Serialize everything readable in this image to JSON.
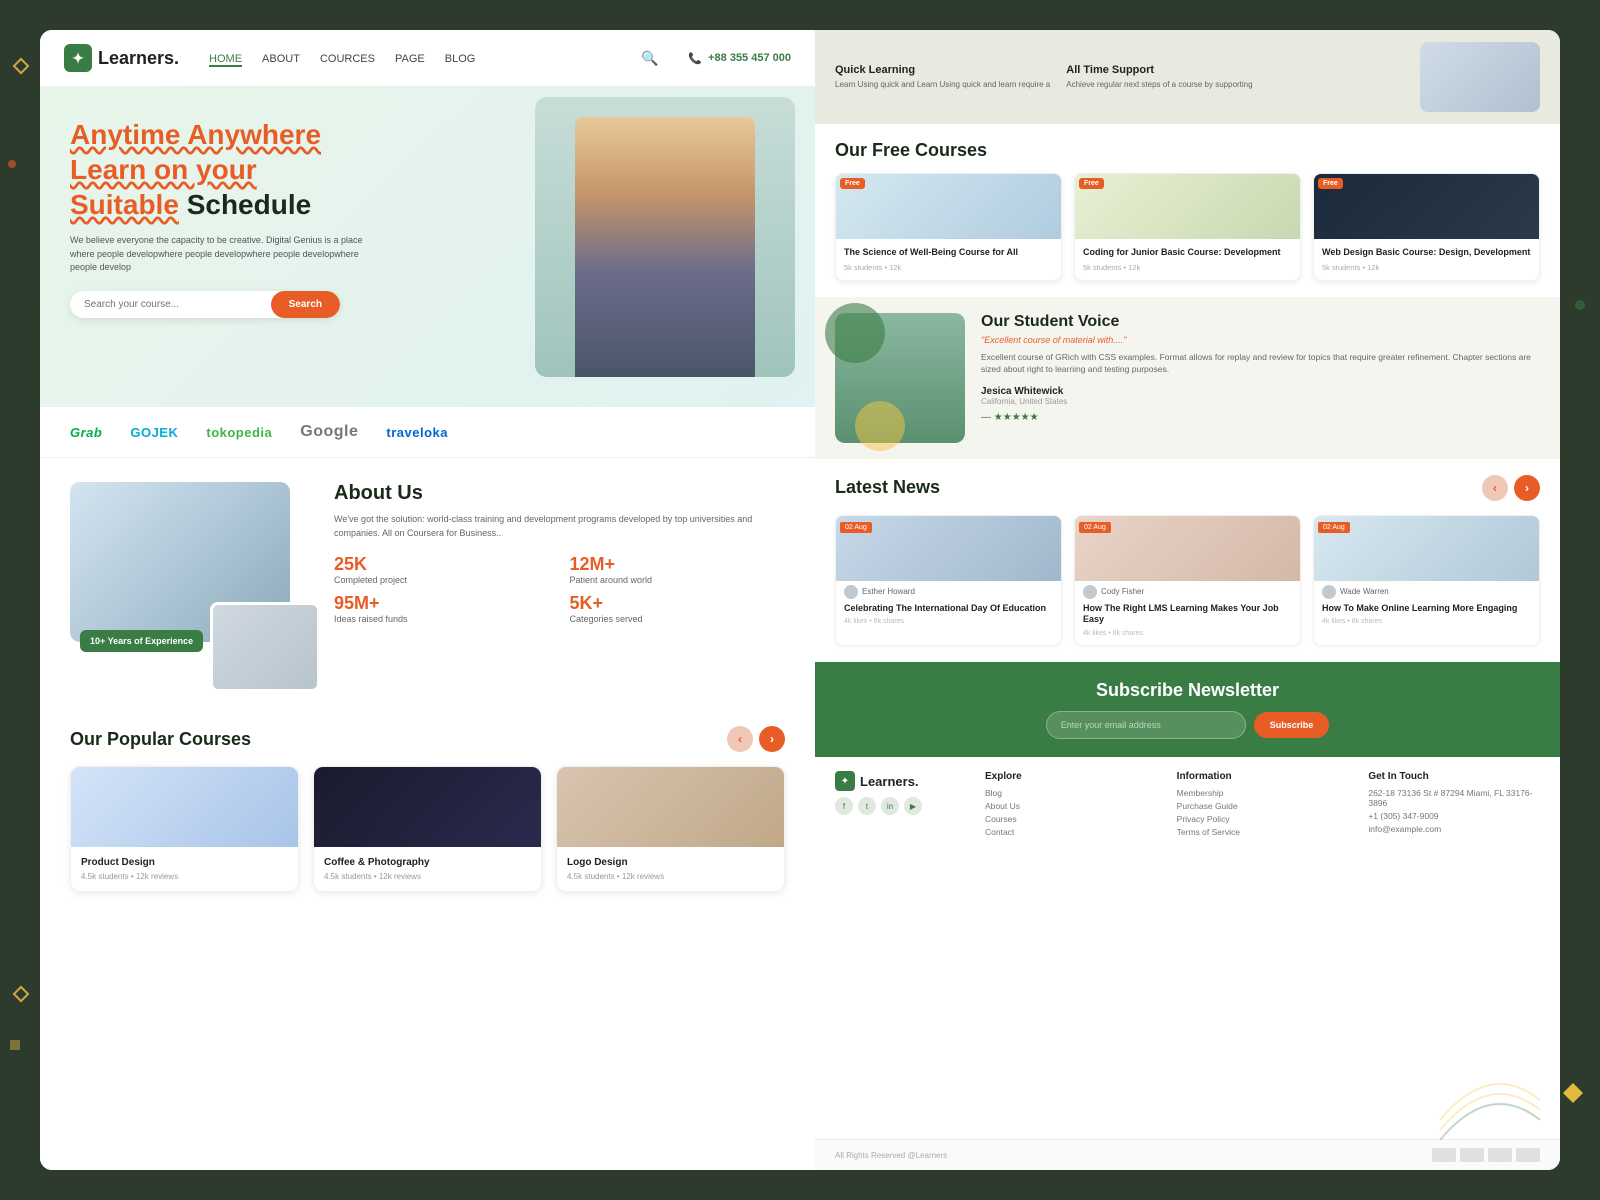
{
  "site": {
    "name": "Learners.",
    "tagline": "Anytime Anywhere Learn on your Suitable Schedule"
  },
  "nav": {
    "links": [
      "HOME",
      "ABOUT",
      "COURCES",
      "PAGE",
      "BLOG"
    ],
    "active": "HOME",
    "phone": "+88 355 457 000"
  },
  "hero": {
    "headline_line1": "Anytime Anywhere",
    "headline_line2": "Learn on your",
    "headline_line3_part1": "Suitable",
    "headline_line3_part2": "Schedule",
    "description": "We believe everyone the capacity to be creative. Digital Genius is a place where people developwhere people developwhere people developwhere people develop",
    "search_placeholder": "Search your course...",
    "search_button": "Search"
  },
  "partners": [
    {
      "name": "Grab",
      "class": "grab"
    },
    {
      "name": "GOJEK",
      "class": "gojek"
    },
    {
      "name": "tokopedia",
      "class": "tokopedia"
    },
    {
      "name": "Google",
      "class": "google"
    },
    {
      "name": "traveloka",
      "class": "traveloka"
    }
  ],
  "about": {
    "title": "About Us",
    "description": "We've got the solution: world-class training and development programs developed by top universities and companies. All on Coursera for Business..",
    "experience_badge": "10+ Years of Experience",
    "stats": [
      {
        "num": "25K",
        "label": "Completed project"
      },
      {
        "num": "12M+",
        "label": "Patient around world"
      },
      {
        "num": "95M+",
        "label": "Ideas raised funds"
      },
      {
        "num": "5K+",
        "label": "Categories served"
      }
    ]
  },
  "popular_courses": {
    "title": "Our Popular Courses",
    "courses": [
      {
        "name": "Product Design",
        "meta": "4.5k students • 12k reviews",
        "thumb_class": "t1"
      },
      {
        "name": "Coffee & Photography",
        "meta": "4.5k students • 12k reviews",
        "thumb_class": "t2"
      },
      {
        "name": "Logo Design",
        "meta": "4.5k students • 12k reviews",
        "thumb_class": "t3"
      }
    ]
  },
  "free_courses": {
    "title": "Our Free Courses",
    "courses": [
      {
        "name": "The Science of Well-Being Course for All",
        "meta": "5k students • 12k",
        "thumb_class": "fc1",
        "badge": "Free"
      },
      {
        "name": "Coding for Junior Basic Course: Development",
        "meta": "5k students • 12k",
        "thumb_class": "fc2",
        "badge": "Free"
      },
      {
        "name": "Web Design Basic Course: Design, Development",
        "meta": "5k students • 12k",
        "thumb_class": "fc3",
        "badge": "Free"
      }
    ]
  },
  "student_voice": {
    "title": "Our Student Voice",
    "quote": "\"Excellent course of material with....\"",
    "text": "Excellent course of GRich with CSS examples. Format allows for replay and review for topics that require greater refinement. Chapter sections are sized about right to learning and testing purposes.",
    "author": "Jesica Whitewick",
    "location": "California, United States"
  },
  "features": [
    {
      "title": "Quick Learning",
      "desc": "Learn Using quick and Learn Using quick and learn require a"
    },
    {
      "title": "All Time Support",
      "desc": "Achieve regular next steps of a course by supporting"
    }
  ],
  "latest_news": {
    "title": "Latest News",
    "news": [
      {
        "date": "02 Aug",
        "author": "Esther Howard",
        "title": "Celebrating The International Day Of Education",
        "meta": "4k likes • 8k shares",
        "thumb": "n1"
      },
      {
        "date": "02 Aug",
        "author": "Cody Fisher",
        "title": "How The Right LMS Learning Makes Your Job Easy",
        "meta": "4k likes • 8k shares",
        "thumb": "n2"
      },
      {
        "date": "02 Aug",
        "author": "Wade Warren",
        "title": "How To Make Online Learning More Engaging",
        "meta": "4k likes • 8k shares",
        "thumb": "n3"
      }
    ]
  },
  "subscribe": {
    "title": "Subscribe Newsletter",
    "placeholder": "Enter your email address",
    "button": "Subscribe"
  },
  "footer": {
    "explore_title": "Explore",
    "explore_links": [
      "Blog",
      "About Us",
      "Courses",
      "Contact"
    ],
    "info_title": "Information",
    "info_links": [
      "Membership",
      "Purchase Guide",
      "Privacy Policy",
      "Terms of Service"
    ],
    "contact_title": "Get In Touch",
    "address": "262-18 73136 St # 87294 Miami, FL 33176-3896",
    "phone": "+1 (305) 347-9009",
    "email": "info@example.com",
    "copyright": "All Rights Reserved @Learners"
  },
  "colors": {
    "primary_green": "#3a7d44",
    "accent_orange": "#e85d26",
    "light_bg": "#e8f5e9",
    "dark_bg": "#2d3b2d"
  }
}
